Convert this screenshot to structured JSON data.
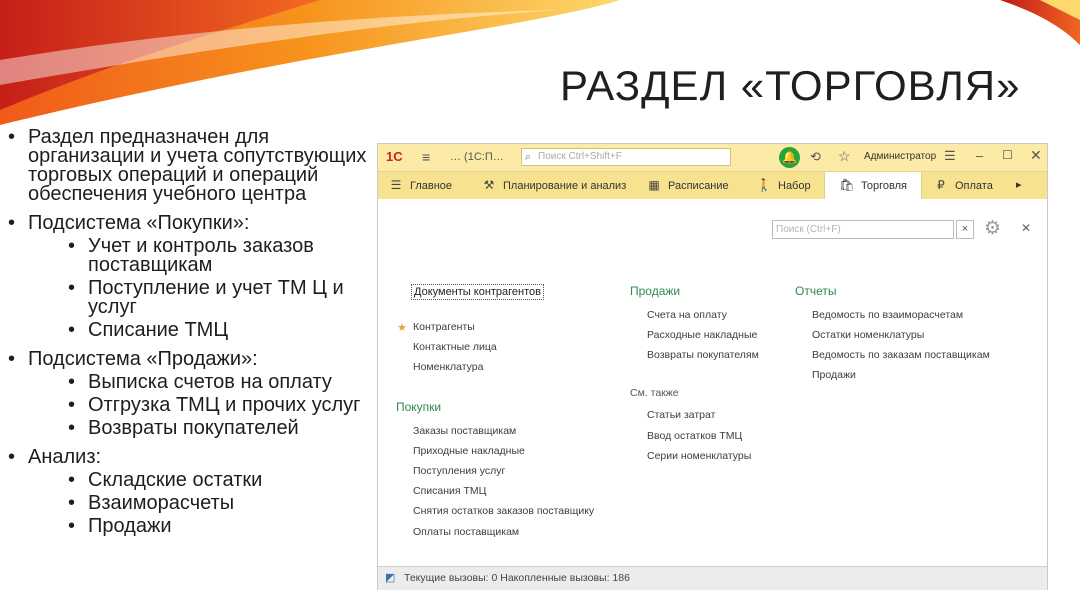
{
  "slide": {
    "title": "РАЗДЕЛ «ТОРГОВЛЯ»",
    "bullets": [
      {
        "text": "Раздел предназначен для организации и учета сопутствующих торговых операций и операций обеспечения учебного центра",
        "sub": []
      },
      {
        "text": "Подсистема «Покупки»:",
        "sub": [
          "Учет и контроль заказов поставщикам",
          "Поступление и учет ТМ Ц и услуг",
          "Списание ТМЦ"
        ]
      },
      {
        "text": "Подсистема «Продажи»:",
        "sub": [
          "Выписка счетов на оплату",
          "Отгрузка ТМЦ и прочих услуг",
          "Возвраты покупателей"
        ]
      },
      {
        "text": "Анализ:",
        "sub": [
          "Складские остатки",
          "Взаиморасчеты",
          "Продажи"
        ]
      }
    ]
  },
  "window": {
    "topbar": {
      "logo": "1С",
      "app_title": "… (1С:П…",
      "search_placeholder": "Поиск Ctrl+Shift+F",
      "user": "Администратор"
    },
    "nav": [
      {
        "label": "Главное",
        "icon": "☰"
      },
      {
        "label": "Планирование и анализ",
        "icon": "⚒"
      },
      {
        "label": "Расписание",
        "icon": "▦"
      },
      {
        "label": "Набор",
        "icon": "🚶"
      },
      {
        "label": "Торговля",
        "icon": "🛍"
      },
      {
        "label": "Оплата",
        "icon": "₽"
      }
    ],
    "content": {
      "search_placeholder": "Поиск (Ctrl+F)",
      "clear": "×",
      "documents_header": "Документы контрагентов",
      "documents_links": [
        "Контрагенты",
        "Контактные лица",
        "Номенклатура"
      ],
      "purchases_header": "Покупки",
      "purchases_links": [
        "Заказы поставщикам",
        "Приходные накладные",
        "Поступления услуг",
        "Списания ТМЦ",
        "Снятия остатков заказов поставщику",
        "Оплаты поставщикам"
      ],
      "sales_header": "Продажи",
      "sales_links": [
        "Счета на оплату",
        "Расходные накладные",
        "Возвраты покупателям"
      ],
      "see_also_label": "См. также",
      "see_also_links": [
        "Статьи затрат",
        "Ввод остатков ТМЦ",
        "Серии номенклатуры"
      ],
      "reports_header": "Отчеты",
      "reports_links": [
        "Ведомость по взаиморасчетам",
        "Остатки номенклатуры",
        "Ведомость по заказам поставщикам",
        "Продажи"
      ]
    },
    "status": "Текущие вызовы: 0   Накопленные вызовы: 186"
  },
  "colors": {
    "topbar": "#fbeba7",
    "navbar": "#f7e38f",
    "section_green": "#2c8a4f",
    "bell_green": "#2aa33e"
  }
}
